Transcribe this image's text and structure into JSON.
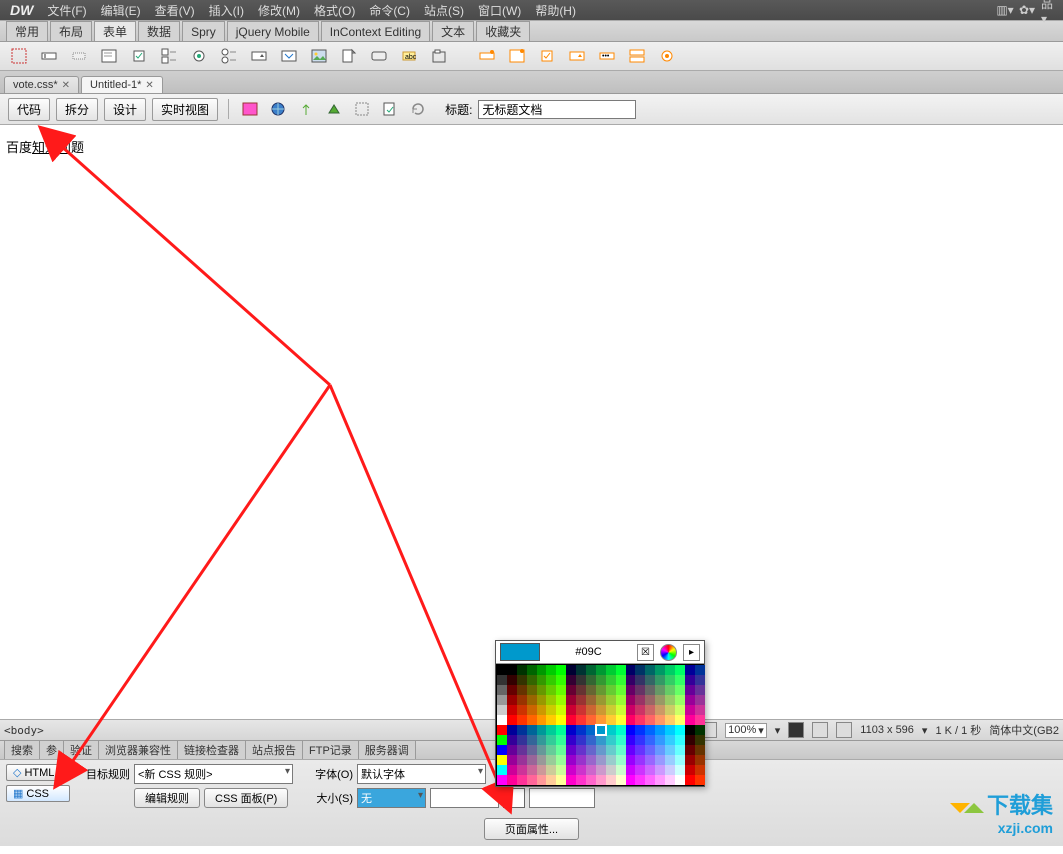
{
  "app": {
    "logo": "DW"
  },
  "menu": {
    "file": "文件(F)",
    "edit": "编辑(E)",
    "view": "查看(V)",
    "insert": "插入(I)",
    "modify": "修改(M)",
    "format": "格式(O)",
    "command": "命令(C)",
    "site": "站点(S)",
    "window": "窗口(W)",
    "help": "帮助(H)"
  },
  "insert_tabs": {
    "common": "常用",
    "layout": "布局",
    "forms": "表单",
    "data": "数据",
    "spry": "Spry",
    "jqm": "jQuery Mobile",
    "ice": "InContext Editing",
    "text": "文本",
    "fav": "收藏夹"
  },
  "file_tabs": [
    {
      "label": "vote.css*",
      "active": false
    },
    {
      "label": "Untitled-1*",
      "active": true
    }
  ],
  "doc_toolbar": {
    "code": "代码",
    "split": "拆分",
    "design": "设计",
    "live": "实时视图",
    "title_label": "标题:",
    "title_value": "无标题文档"
  },
  "canvas": {
    "sample_pre": "百度",
    "sample_ul": "知道问",
    "sample_post": "题"
  },
  "statusbar": {
    "body": "<body>",
    "zoom": "100%",
    "dims": "1103 x 596",
    "size": "1 K / 1 秒",
    "encoding": "简体中文(GB2"
  },
  "results_tabs": {
    "search": "搜索",
    "ref": "参",
    "validate": "验证",
    "browser": "浏览器兼容性",
    "link": "链接检查器",
    "sitereport": "站点报告",
    "ftp": "FTP记录",
    "server": "服务器调"
  },
  "properties": {
    "html_btn": "HTML",
    "css_btn": "CSS",
    "target_rule_label": "目标规则",
    "target_rule_value": "<新 CSS 规则>",
    "edit_rule": "编辑规则",
    "css_panel": "CSS 面板(P)",
    "font_label": "字体(O)",
    "font_value": "默认字体",
    "size_label": "大小(S)",
    "size_value": "无",
    "page_props": "页面属性..."
  },
  "color_picker": {
    "hex": "#09C",
    "selected": "#0099cc"
  },
  "watermark": {
    "line1": "下载集",
    "line2": "xzji.com"
  }
}
